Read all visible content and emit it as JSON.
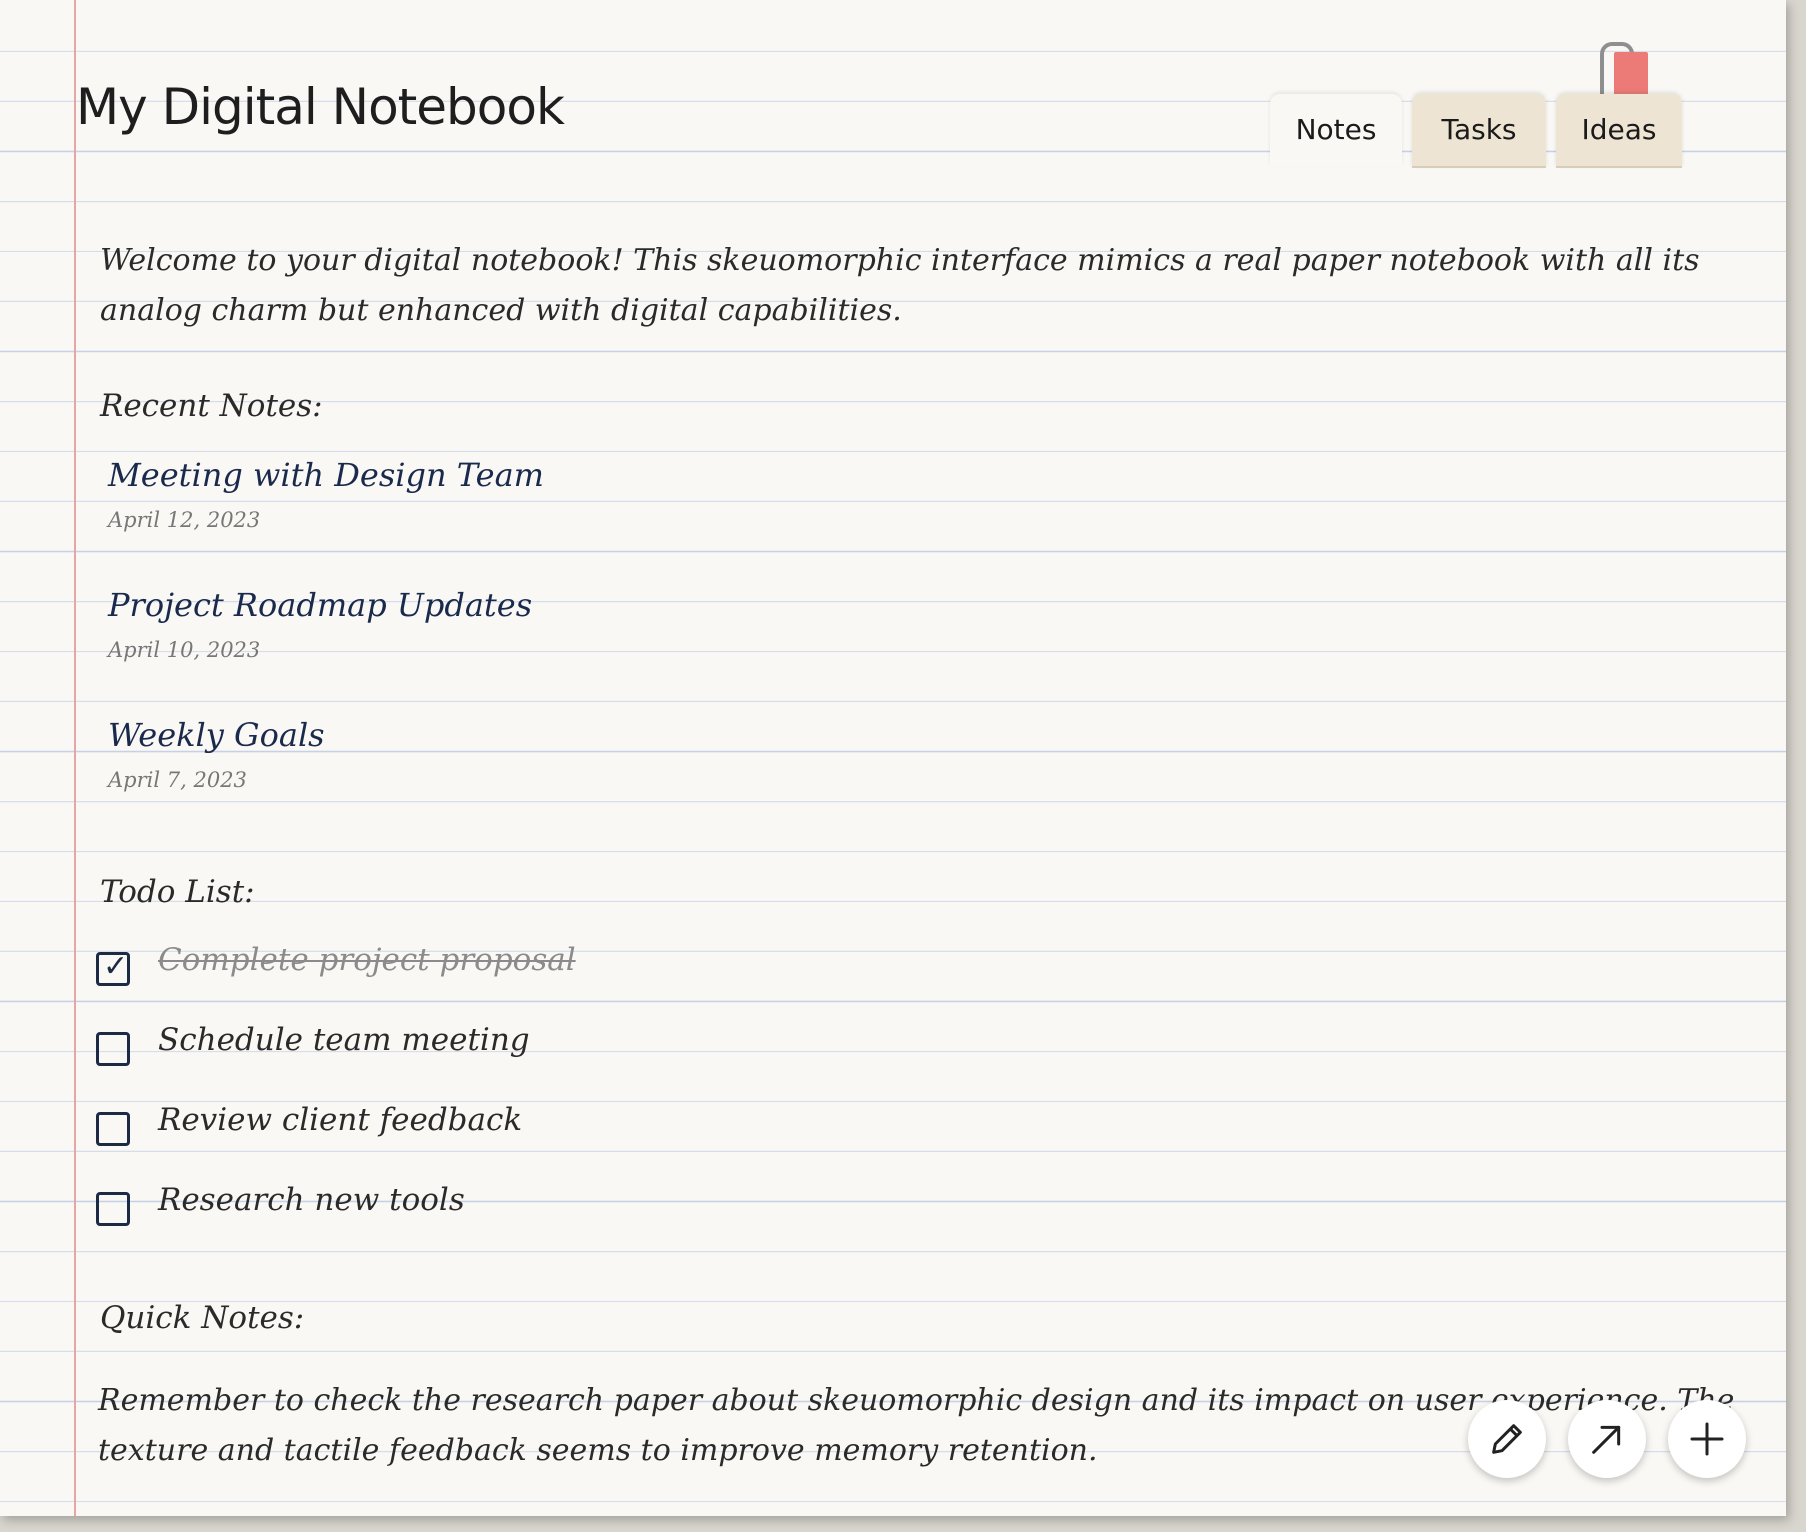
{
  "header": {
    "title": "My Digital Notebook"
  },
  "tabs": [
    {
      "label": "Notes",
      "active": true
    },
    {
      "label": "Tasks",
      "active": false
    },
    {
      "label": "Ideas",
      "active": false
    }
  ],
  "intro": "Welcome to your digital notebook! This skeuomorphic interface mimics a real paper notebook with all its analog charm but enhanced with digital capabilities.",
  "recent_notes": {
    "label": "Recent Notes:",
    "items": [
      {
        "title": "Meeting with Design Team",
        "date": "April 12, 2023"
      },
      {
        "title": "Project Roadmap Updates",
        "date": "April 10, 2023"
      },
      {
        "title": "Weekly Goals",
        "date": "April 7, 2023"
      }
    ]
  },
  "todo": {
    "label": "Todo List:",
    "items": [
      {
        "text": "Complete project proposal",
        "done": true
      },
      {
        "text": "Schedule team meeting",
        "done": false
      },
      {
        "text": "Review client feedback",
        "done": false
      },
      {
        "text": "Research new tools",
        "done": false
      }
    ]
  },
  "quick_notes": {
    "label": "Quick Notes:",
    "text": "Remember to check the research paper about skeuomorphic design and its impact on user experience. The texture and tactile feedback seems to improve memory retention."
  },
  "fab_buttons": [
    {
      "icon": "pencil-icon"
    },
    {
      "icon": "share-arrow-icon"
    },
    {
      "icon": "plus-icon"
    }
  ],
  "colors": {
    "paper": "#faf8f4",
    "rule_line": "#c5d1e6",
    "margin_line": "#e8a5a5",
    "ink_blue": "#1a2a4d",
    "bookmark": "#ec7b78",
    "tab_inactive": "#ede4d3"
  }
}
